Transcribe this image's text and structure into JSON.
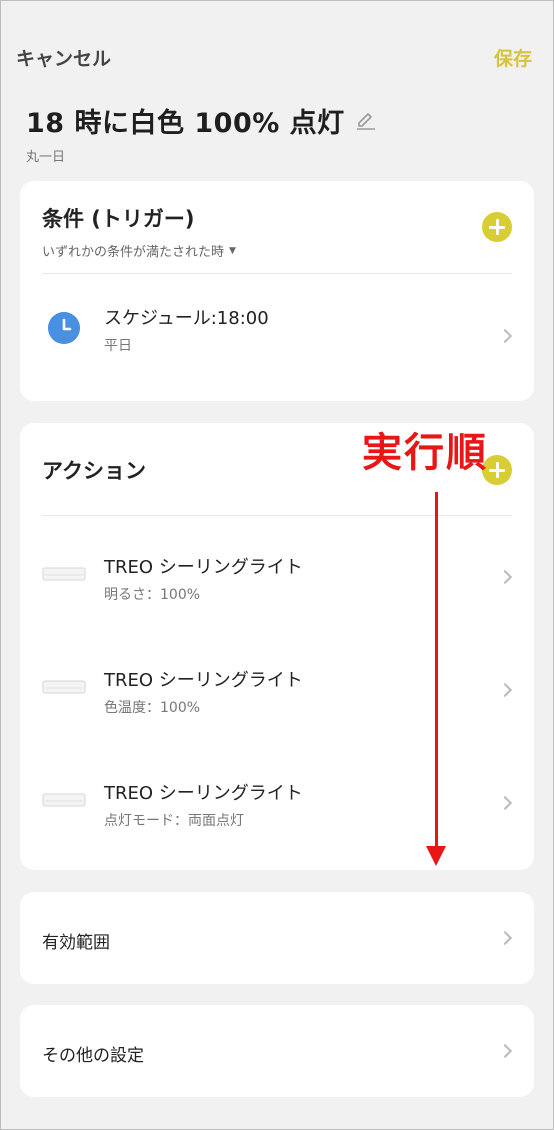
{
  "header": {
    "cancel_label": "キャンセル",
    "save_label": "保存"
  },
  "scene": {
    "title": "18 時に白色 100% 点灯",
    "subtitle": "丸一日"
  },
  "conditions": {
    "title": "条件 (トリガー)",
    "mode": "いずれかの条件が満たされた時",
    "items": [
      {
        "title": "スケジュール:18:00",
        "sub": "平日",
        "icon": "clock-icon"
      }
    ]
  },
  "actions": {
    "title": "アクション",
    "items": [
      {
        "title": "TREO シーリングライト",
        "sub": "明るさ：100%",
        "icon": "ceiling-light-icon"
      },
      {
        "title": "TREO シーリングライト",
        "sub": "色温度：100%",
        "icon": "ceiling-light-icon"
      },
      {
        "title": "TREO シーリングライト",
        "sub": "点灯モード：両面点灯",
        "icon": "ceiling-light-icon"
      }
    ]
  },
  "valid_range": {
    "label": "有効範囲"
  },
  "other_settings": {
    "label": "その他の設定"
  },
  "annotation": {
    "text": "実行順"
  },
  "colors": {
    "accent": "#d9cd35",
    "save_text": "#d8c33a",
    "annotation": "#e91616",
    "clock": "#4a90e2",
    "background": "#f1f1f1"
  }
}
